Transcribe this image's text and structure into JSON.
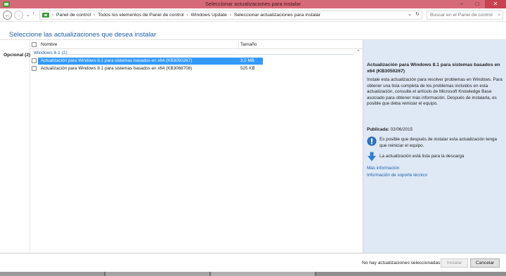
{
  "window": {
    "title": "Seleccionar actualizaciones para instalar",
    "minimize_glyph": "−",
    "maximize_glyph": "□",
    "close_glyph": "✕"
  },
  "addressbar": {
    "back_glyph": "←",
    "forward_glyph": "→",
    "dropdown_glyph": "⌄",
    "up_glyph": "↑",
    "crumb_sep": "›",
    "breadcrumbs": [
      "Panel de control",
      "Todos los elementos de Panel de control",
      "Windows Update",
      "Seleccionar actualizaciones para instalar"
    ],
    "dropdown_right_glyph": "⌄",
    "refresh_glyph": "↻",
    "search_placeholder": "Buscar en el Panel de control",
    "search_glyph": "⌕"
  },
  "header": {
    "title": "Seleccione las actualizaciones que desea instalar"
  },
  "categories": [
    {
      "label": "Opcional (2)"
    }
  ],
  "list": {
    "col_name": "Nombre",
    "col_size": "Tamaño",
    "group": {
      "label": "Windows 8.1 (2)",
      "chevron": "⌃"
    },
    "rows": [
      {
        "name": "Actualización para Windows 8.1 para sistemas basados en x64 (KB3050267)",
        "size": "3,5 MB",
        "selected": true
      },
      {
        "name": "Actualización para Windows 8.1 para sistemas basados en x64 (KB3068708)",
        "size": "525 KB",
        "selected": false
      }
    ]
  },
  "details": {
    "title": "Actualización para Windows 8.1 para sistemas basados en x64 (KB3050267)",
    "description": "Instale esta actualización para resolver problemas en Windows. Para obtener una lista completa de los problemas incluidos en esta actualización, consulte el artículo de Microsoft Knowledge Base asociado para obtener más información. Después de instalarla, es posible que deba reiniciar el equipo.",
    "published_label": "Publicada:",
    "published_date": "02/06/2015",
    "restart_note": "Es posible que después de instalar esta actualización tenga que reiniciar el equipo.",
    "download_note": "La actualización está lista para la descarga",
    "more_info_link": "Más información",
    "support_link": "Información de soporte técnico"
  },
  "footer": {
    "status": "No hay actualizaciones seleccionadas.",
    "install_label": "Instalar",
    "cancel_label": "Cancelar"
  },
  "colors": {
    "titlebar": "#d66a78",
    "accent": "#1d5fa8",
    "selection": "#3399ff",
    "details_bg": "#dfe9f6"
  }
}
